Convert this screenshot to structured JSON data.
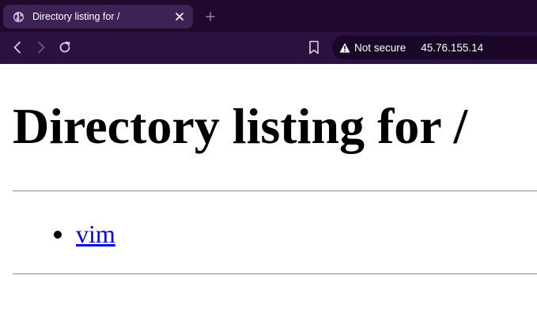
{
  "browser": {
    "tab": {
      "title": "Directory listing for /"
    },
    "address_bar": {
      "security_label": "Not secure",
      "url": "45.76.155.14"
    }
  },
  "page": {
    "heading": "Directory listing for /",
    "entries": [
      {
        "name": "vim"
      }
    ]
  },
  "colors": {
    "tabbar_bg": "#1f0a2e",
    "toolbar_bg": "#2a1140",
    "active_tab_bg": "#3d2256",
    "link": "#0000ee"
  },
  "icons": {
    "tab_favicon": "globe-icon",
    "tab_close": "close-icon",
    "new_tab": "plus-icon",
    "back": "back-arrow-icon",
    "forward": "forward-arrow-icon",
    "reload": "reload-icon",
    "bookmark": "bookmark-icon",
    "security": "warning-icon"
  }
}
